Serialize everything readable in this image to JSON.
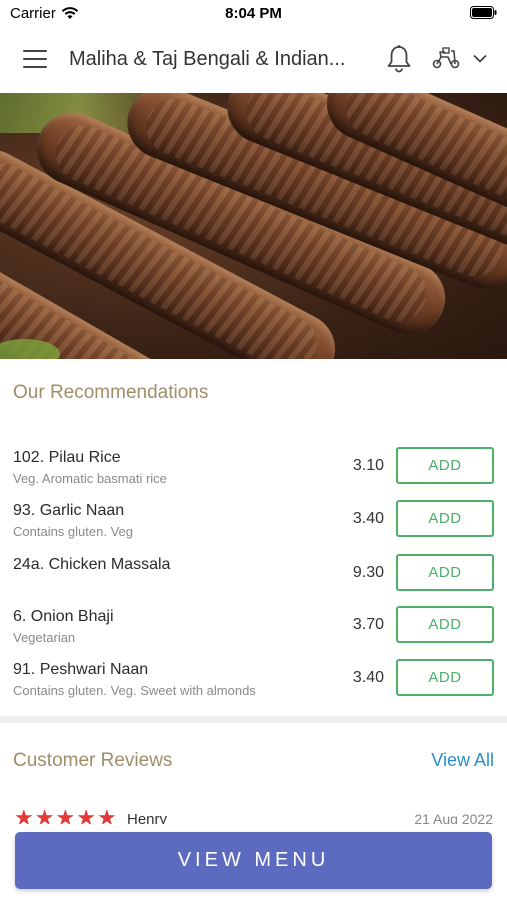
{
  "status_bar": {
    "carrier": "Carrier",
    "time": "8:04 PM"
  },
  "header": {
    "title": "Maliha & Taj Bengali & Indian..."
  },
  "icons": {
    "menu": "hamburger-icon",
    "notifications": "bell-icon",
    "delivery": "scooter-icon",
    "expand": "chevron-down-icon"
  },
  "recommendations": {
    "title": "Our Recommendations",
    "add_label": "ADD",
    "items": [
      {
        "name": "102. Pilau Rice",
        "description": "Veg. Aromatic basmati rice",
        "price": "3.10"
      },
      {
        "name": "93. Garlic Naan",
        "description": "Contains gluten. Veg",
        "price": "3.40"
      },
      {
        "name": "24a. Chicken Massala",
        "description": "",
        "price": "9.30"
      },
      {
        "name": "6. Onion Bhaji",
        "description": "Vegetarian",
        "price": "3.70"
      },
      {
        "name": "91. Peshwari Naan",
        "description": "Contains gluten. Veg. Sweet with almonds",
        "price": "3.40"
      }
    ]
  },
  "reviews": {
    "title": "Customer Reviews",
    "view_all": "View All",
    "first": {
      "rating": 5,
      "reviewer": "Henry",
      "date": "21 Aug 2022"
    }
  },
  "cta": {
    "label": "VIEW MENU"
  },
  "colors": {
    "accent": "#5c6bc0",
    "add_green": "#4caf6a",
    "section_title": "#a08e6a",
    "link": "#2d8fc9",
    "star": "#e03a3a"
  }
}
